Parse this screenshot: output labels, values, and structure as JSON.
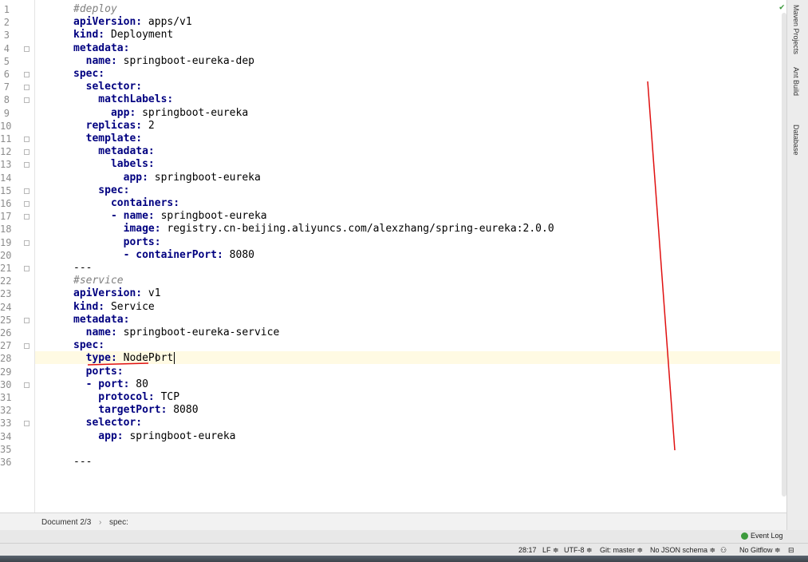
{
  "editor": {
    "lines": [
      {
        "n": "1",
        "parts": [
          {
            "t": "#deploy",
            "c": "c"
          }
        ]
      },
      {
        "n": "2",
        "parts": [
          {
            "t": "apiVersion:",
            "c": "k"
          },
          {
            "t": " apps/v1",
            "c": "v"
          }
        ]
      },
      {
        "n": "3",
        "parts": [
          {
            "t": "kind:",
            "c": "k"
          },
          {
            "t": " Deployment",
            "c": "v"
          }
        ]
      },
      {
        "n": "4",
        "parts": [
          {
            "t": "metadata:",
            "c": "k"
          }
        ]
      },
      {
        "n": "5",
        "parts": [
          {
            "t": "  name:",
            "c": "k"
          },
          {
            "t": " springboot-eureka-dep",
            "c": "v"
          }
        ]
      },
      {
        "n": "6",
        "parts": [
          {
            "t": "spec:",
            "c": "k"
          }
        ]
      },
      {
        "n": "7",
        "parts": [
          {
            "t": "  selector:",
            "c": "k"
          }
        ]
      },
      {
        "n": "8",
        "parts": [
          {
            "t": "    matchLabels:",
            "c": "k"
          }
        ]
      },
      {
        "n": "9",
        "parts": [
          {
            "t": "      app:",
            "c": "k"
          },
          {
            "t": " springboot-eureka",
            "c": "v"
          }
        ]
      },
      {
        "n": "10",
        "parts": [
          {
            "t": "  replicas:",
            "c": "k"
          },
          {
            "t": " 2",
            "c": "v"
          }
        ]
      },
      {
        "n": "11",
        "parts": [
          {
            "t": "  template:",
            "c": "k"
          }
        ]
      },
      {
        "n": "12",
        "parts": [
          {
            "t": "    metadata:",
            "c": "k"
          }
        ]
      },
      {
        "n": "13",
        "parts": [
          {
            "t": "      labels:",
            "c": "k"
          }
        ]
      },
      {
        "n": "14",
        "parts": [
          {
            "t": "        app:",
            "c": "k"
          },
          {
            "t": " springboot-eureka",
            "c": "v"
          }
        ]
      },
      {
        "n": "15",
        "parts": [
          {
            "t": "    spec:",
            "c": "k"
          }
        ]
      },
      {
        "n": "16",
        "parts": [
          {
            "t": "      containers:",
            "c": "k"
          }
        ]
      },
      {
        "n": "17",
        "parts": [
          {
            "t": "      - name:",
            "c": "k"
          },
          {
            "t": " springboot-eureka",
            "c": "v"
          }
        ]
      },
      {
        "n": "18",
        "parts": [
          {
            "t": "        image:",
            "c": "k"
          },
          {
            "t": " registry.cn-beijing.aliyuncs.com/alexzhang/spring-eureka:2.0.0",
            "c": "v"
          }
        ]
      },
      {
        "n": "19",
        "parts": [
          {
            "t": "        ports:",
            "c": "k"
          }
        ]
      },
      {
        "n": "20",
        "parts": [
          {
            "t": "        - containerPort:",
            "c": "k"
          },
          {
            "t": " 8080",
            "c": "v"
          }
        ]
      },
      {
        "n": "21",
        "parts": [
          {
            "t": "---",
            "c": "v"
          }
        ]
      },
      {
        "n": "22",
        "parts": [
          {
            "t": "#service",
            "c": "c"
          }
        ]
      },
      {
        "n": "23",
        "parts": [
          {
            "t": "apiVersion:",
            "c": "k"
          },
          {
            "t": " v1",
            "c": "v"
          }
        ]
      },
      {
        "n": "24",
        "parts": [
          {
            "t": "kind:",
            "c": "k"
          },
          {
            "t": " Service",
            "c": "v"
          }
        ]
      },
      {
        "n": "25",
        "parts": [
          {
            "t": "metadata:",
            "c": "k"
          }
        ]
      },
      {
        "n": "26",
        "parts": [
          {
            "t": "  name:",
            "c": "k"
          },
          {
            "t": " springboot-eureka-service",
            "c": "v"
          }
        ]
      },
      {
        "n": "27",
        "parts": [
          {
            "t": "spec:",
            "c": "k"
          }
        ]
      },
      {
        "n": "28",
        "parts": [
          {
            "t": "  type:",
            "c": "k"
          },
          {
            "t": " NodePort",
            "c": "v"
          }
        ]
      },
      {
        "n": "29",
        "parts": [
          {
            "t": "  ports:",
            "c": "k"
          }
        ]
      },
      {
        "n": "30",
        "parts": [
          {
            "t": "  - port:",
            "c": "k"
          },
          {
            "t": " 80",
            "c": "v"
          }
        ]
      },
      {
        "n": "31",
        "parts": [
          {
            "t": "    protocol:",
            "c": "k"
          },
          {
            "t": " TCP",
            "c": "v"
          }
        ]
      },
      {
        "n": "32",
        "parts": [
          {
            "t": "    targetPort:",
            "c": "k"
          },
          {
            "t": " 8080",
            "c": "v"
          }
        ]
      },
      {
        "n": "33",
        "parts": [
          {
            "t": "  selector:",
            "c": "k"
          }
        ]
      },
      {
        "n": "34",
        "parts": [
          {
            "t": "    app:",
            "c": "k"
          },
          {
            "t": " springboot-eureka",
            "c": "v"
          }
        ]
      },
      {
        "n": "35",
        "parts": []
      },
      {
        "n": "36",
        "parts": [
          {
            "t": "---",
            "c": "v"
          }
        ]
      }
    ]
  },
  "right_tabs": {
    "maven": "Maven Projects",
    "ant": "Ant Build",
    "database": "Database"
  },
  "breadcrumb": {
    "doc": "Document 2/3",
    "sep": "›",
    "node": "spec:"
  },
  "event_log": {
    "label": "Event Log"
  },
  "status": {
    "position": "28:17",
    "line_sep": "LF ≑",
    "encoding": "UTF-8 ≑",
    "git": "Git: master ≑",
    "schema": "No JSON schema ≑",
    "gitflow": "No Gitflow ≑"
  },
  "colors": {
    "key": "#000080",
    "comment": "#808080",
    "caret_row": "#fffae3",
    "annotation": "#e01010"
  }
}
